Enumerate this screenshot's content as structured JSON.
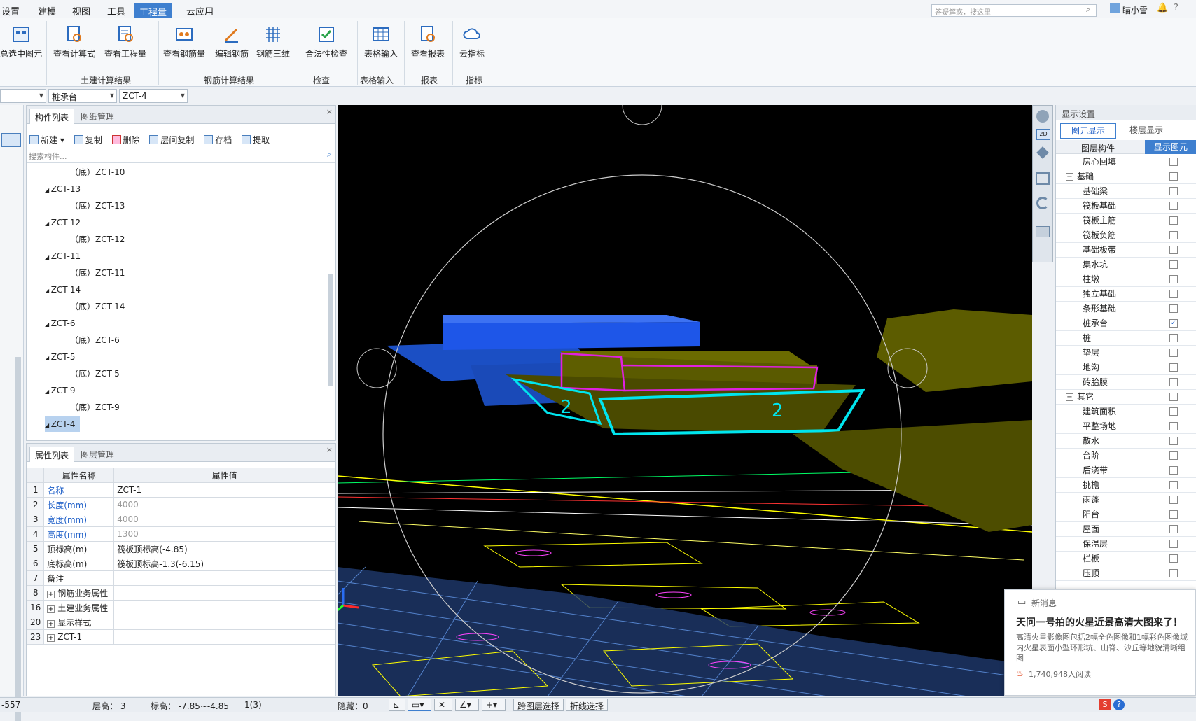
{
  "menu": {
    "items": [
      "设置",
      "建模",
      "视图",
      "工具",
      "工程量",
      "云应用"
    ],
    "active_index": 4
  },
  "search": {
    "placeholder": "答疑解惑，搜这里"
  },
  "user": {
    "name": "瞄小雪"
  },
  "ribbon": {
    "buttons": [
      "总选中图元",
      "查看计算式",
      "查看工程量",
      "查看钢筋量",
      "编辑钢筋",
      "钢筋三维",
      "合法性检查",
      "表格输入",
      "查看报表",
      "云指标"
    ],
    "groups": [
      "土建计算结果",
      "钢筋计算结果",
      "检查",
      "表格输入",
      "报表",
      "指标"
    ]
  },
  "selectors": {
    "floor": "",
    "type": "桩承台",
    "component": "ZCT-4"
  },
  "component_panel": {
    "tabs": [
      "构件列表",
      "图纸管理"
    ],
    "toolbar": [
      "新建",
      "复制",
      "删除",
      "层间复制",
      "存档",
      "提取"
    ],
    "search_placeholder": "搜索构件...",
    "tree": [
      {
        "label": "（底）ZCT-10",
        "level": 2
      },
      {
        "label": "ZCT-13",
        "level": 1
      },
      {
        "label": "（底）ZCT-13",
        "level": 2
      },
      {
        "label": "ZCT-12",
        "level": 1
      },
      {
        "label": "（底）ZCT-12",
        "level": 2
      },
      {
        "label": "ZCT-11",
        "level": 1
      },
      {
        "label": "（底）ZCT-11",
        "level": 2
      },
      {
        "label": "ZCT-14",
        "level": 1
      },
      {
        "label": "（底）ZCT-14",
        "level": 2
      },
      {
        "label": "ZCT-6",
        "level": 1
      },
      {
        "label": "（底）ZCT-6",
        "level": 2
      },
      {
        "label": "ZCT-5",
        "level": 1
      },
      {
        "label": "（底）ZCT-5",
        "level": 2
      },
      {
        "label": "ZCT-9",
        "level": 1
      },
      {
        "label": "（底）ZCT-9",
        "level": 2
      },
      {
        "label": "ZCT-4",
        "level": 1,
        "selected": true
      }
    ]
  },
  "property_panel": {
    "tabs": [
      "属性列表",
      "图层管理"
    ],
    "headers": [
      "属性名称",
      "属性值"
    ],
    "rows": [
      {
        "n": "1",
        "name": "名称",
        "value": "ZCT-1",
        "blue": true
      },
      {
        "n": "2",
        "name": "长度(mm)",
        "value": "4000",
        "blue": true,
        "gray": true
      },
      {
        "n": "3",
        "name": "宽度(mm)",
        "value": "4000",
        "blue": true,
        "gray": true
      },
      {
        "n": "4",
        "name": "高度(mm)",
        "value": "1300",
        "blue": true,
        "gray": true
      },
      {
        "n": "5",
        "name": "顶标高(m)",
        "value": "筏板顶标高(-4.85)"
      },
      {
        "n": "6",
        "name": "底标高(m)",
        "value": "筏板顶标高-1.3(-6.15)"
      },
      {
        "n": "7",
        "name": "备注",
        "value": ""
      },
      {
        "n": "8",
        "name": "钢筋业务属性",
        "value": "",
        "expand": true
      },
      {
        "n": "16",
        "name": "土建业务属性",
        "value": "",
        "expand": true
      },
      {
        "n": "20",
        "name": "显示样式",
        "value": "",
        "expand": true
      },
      {
        "n": "23",
        "name": "ZCT-1",
        "value": "",
        "expand": true
      }
    ]
  },
  "display_settings": {
    "title": "显示设置",
    "tabs": [
      "图元显示",
      "楼层显示"
    ],
    "headers": [
      "图层构件",
      "显示图元"
    ],
    "rows": [
      {
        "label": "房心回填",
        "indent": 2,
        "checked": false
      },
      {
        "label": "基础",
        "indent": 1,
        "checked": false,
        "group": true
      },
      {
        "label": "基础梁",
        "indent": 2,
        "checked": false
      },
      {
        "label": "筏板基础",
        "indent": 2,
        "checked": false
      },
      {
        "label": "筏板主筋",
        "indent": 2,
        "checked": false
      },
      {
        "label": "筏板负筋",
        "indent": 2,
        "checked": false
      },
      {
        "label": "基础板带",
        "indent": 2,
        "checked": false
      },
      {
        "label": "集水坑",
        "indent": 2,
        "checked": false
      },
      {
        "label": "柱墩",
        "indent": 2,
        "checked": false
      },
      {
        "label": "独立基础",
        "indent": 2,
        "checked": false
      },
      {
        "label": "条形基础",
        "indent": 2,
        "checked": false
      },
      {
        "label": "桩承台",
        "indent": 2,
        "checked": true
      },
      {
        "label": "桩",
        "indent": 2,
        "checked": false
      },
      {
        "label": "垫层",
        "indent": 2,
        "checked": false
      },
      {
        "label": "地沟",
        "indent": 2,
        "checked": false
      },
      {
        "label": "砖胎膜",
        "indent": 2,
        "checked": false
      },
      {
        "label": "其它",
        "indent": 1,
        "checked": false,
        "group": true
      },
      {
        "label": "建筑面积",
        "indent": 2,
        "checked": false
      },
      {
        "label": "平整场地",
        "indent": 2,
        "checked": false
      },
      {
        "label": "散水",
        "indent": 2,
        "checked": false
      },
      {
        "label": "台阶",
        "indent": 2,
        "checked": false
      },
      {
        "label": "后浇带",
        "indent": 2,
        "checked": false
      },
      {
        "label": "挑檐",
        "indent": 2,
        "checked": false
      },
      {
        "label": "雨蓬",
        "indent": 2,
        "checked": false
      },
      {
        "label": "阳台",
        "indent": 2,
        "checked": false
      },
      {
        "label": "屋面",
        "indent": 2,
        "checked": false
      },
      {
        "label": "保温层",
        "indent": 2,
        "checked": false
      },
      {
        "label": "栏板",
        "indent": 2,
        "checked": false
      },
      {
        "label": "压顶",
        "indent": 2,
        "checked": false
      }
    ]
  },
  "viewport": {
    "annotation_left": "2",
    "annotation_right": "2",
    "navtool_label": "2D"
  },
  "notification": {
    "header": "新消息",
    "title": "天问一号拍的火星近景高清大图来了！",
    "body": "高清火星影像图包括2幅全色图像和1幅彩色图像域内火星表面小型环形坑、山脊、沙丘等地貌清晰组图",
    "reads": "1,740,948人阅读"
  },
  "status": {
    "coord": "-557",
    "floor_height": "层高：  3",
    "elevation": "标高：  -7.85~-4.85",
    "count": "1(3)",
    "hidden": "隐藏：0",
    "btn_cross_layer": "跨图层选择",
    "btn_polyline": "折线选择"
  },
  "colors": {
    "accent": "#3e7fcf",
    "beam": "#e020e0",
    "sketch": "#00e5ee",
    "foundation_blue": "#1e56e8",
    "olive": "#5c5c00"
  }
}
